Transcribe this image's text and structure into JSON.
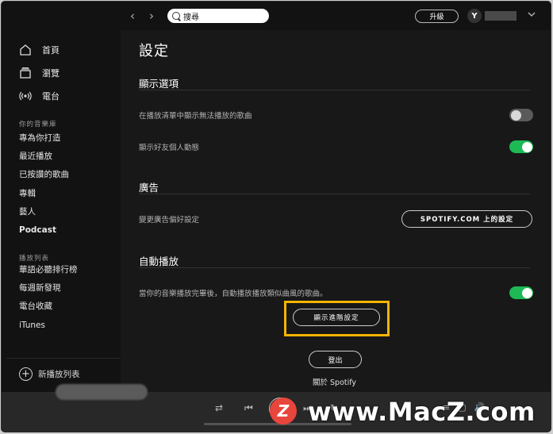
{
  "sidebar": {
    "main_nav": [
      {
        "label": "首頁",
        "icon": "home-icon"
      },
      {
        "label": "瀏覽",
        "icon": "browse-icon"
      },
      {
        "label": "電台",
        "icon": "radio-icon"
      }
    ],
    "library_title": "你的音樂庫",
    "library_items": [
      "專為你打造",
      "最近播放",
      "已按讚的歌曲",
      "專輯",
      "藝人",
      "Podcast"
    ],
    "playlists_title": "播放列表",
    "playlist_items": [
      "華語必聽排行榜",
      "每週新發現",
      "電台收藏",
      "iTunes"
    ],
    "new_playlist": "新播放列表"
  },
  "topbar": {
    "search_placeholder": "搜尋",
    "upgrade": "升級",
    "avatar_letter": "Y"
  },
  "settings": {
    "title": "設定",
    "display": {
      "heading": "顯示選項",
      "row1": "在播放清單中顯示無法播放的歌曲",
      "row1_on": false,
      "row2": "顯示好友個人動態",
      "row2_on": true
    },
    "ads": {
      "heading": "廣告",
      "row": "變更廣告偏好設定",
      "button": "SPOTIFY.COM 上的設定"
    },
    "autoplay": {
      "heading": "自動播放",
      "row": "當你的音樂播放完畢後，自動播放播放類似曲風的歌曲。",
      "row_on": true
    },
    "advanced_button": "顯示進階設定",
    "logout_button": "登出",
    "about": "關於 Spotify"
  },
  "watermark": {
    "logo_letter": "Z",
    "text": "www.MacZ.com"
  },
  "colors": {
    "accent_green": "#1db954",
    "highlight": "#f5b400",
    "background": "#181818"
  }
}
